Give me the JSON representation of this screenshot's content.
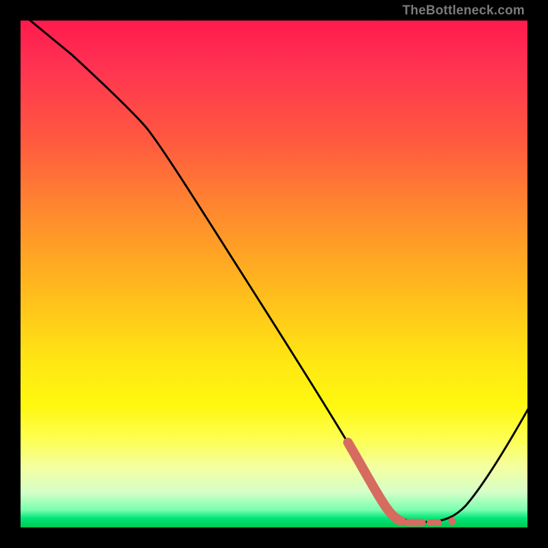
{
  "branding": "TheBottleneck.com",
  "chart_data": {
    "type": "line",
    "title": "",
    "xlabel": "",
    "ylabel": "",
    "xlim": [
      0,
      100
    ],
    "ylim": [
      0,
      100
    ],
    "grid": false,
    "series": [
      {
        "name": "bottleneck-curve",
        "color": "#000000",
        "x": [
          0,
          10,
          20,
          25,
          30,
          40,
          50,
          60,
          65,
          70,
          74,
          78,
          82,
          86,
          90,
          100
        ],
        "y": [
          102,
          93,
          84,
          80,
          75,
          60,
          45,
          29,
          20,
          11,
          4,
          1,
          1,
          2,
          6,
          24
        ]
      },
      {
        "name": "emphasis-range",
        "color": "#d66b60",
        "style": "thick-dashed",
        "x": [
          65,
          68,
          70,
          72,
          74,
          76,
          78,
          80,
          82
        ],
        "y": [
          20,
          14,
          11,
          7,
          4,
          2,
          1,
          1,
          1
        ]
      }
    ],
    "annotations": []
  }
}
